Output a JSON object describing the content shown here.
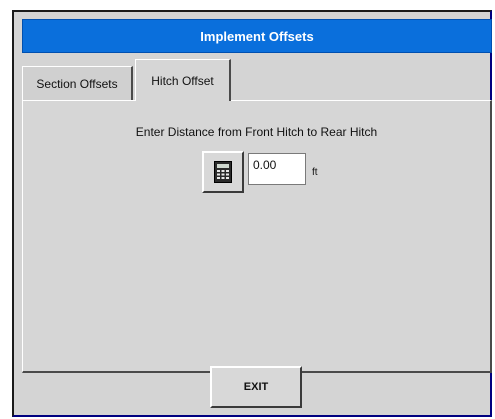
{
  "window": {
    "title": "Implement Offsets"
  },
  "tabs": [
    {
      "label": "Section Offsets",
      "active": false
    },
    {
      "label": "Hitch Offset",
      "active": true
    }
  ],
  "hitch_offset": {
    "prompt": "Enter Distance from Front Hitch to Rear Hitch",
    "value": "0.00",
    "unit": "ft",
    "calculator_icon": "calculator-icon"
  },
  "footer": {
    "exit_label": "EXIT"
  },
  "colors": {
    "titlebar": "#0a6fdc",
    "panel": "#d4d4d4",
    "title_text": "#ffffff"
  }
}
